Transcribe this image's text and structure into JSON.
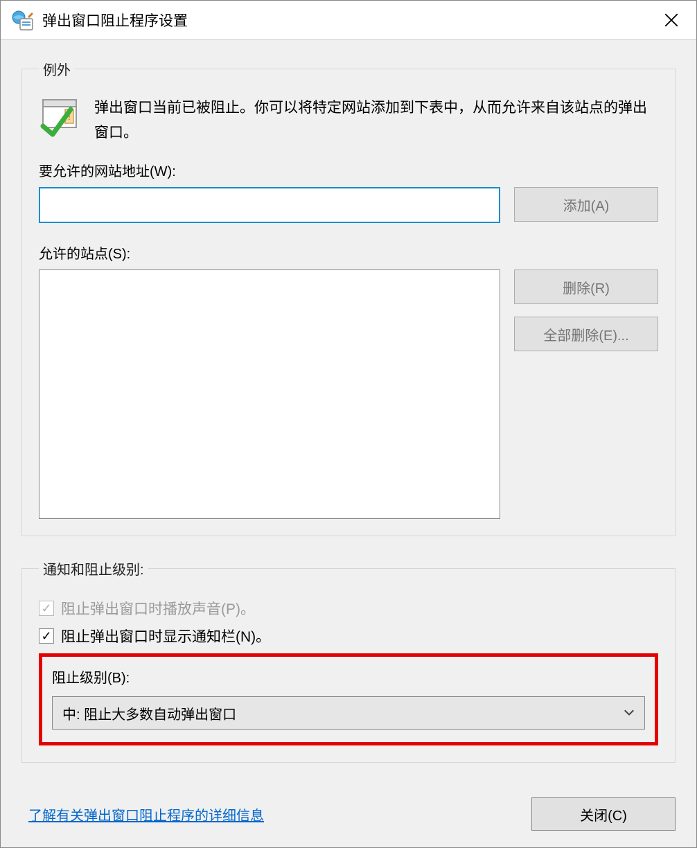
{
  "window": {
    "title": "弹出窗口阻止程序设置"
  },
  "exceptions": {
    "legend": "例外",
    "info": "弹出窗口当前已被阻止。你可以将特定网站添加到下表中，从而允许来自该站点的弹出窗口。",
    "address_label": "要允许的网站地址(W):",
    "add_button": "添加(A)",
    "allowed_label": "允许的站点(S):",
    "remove_button": "删除(R)",
    "remove_all_button": "全部删除(E)..."
  },
  "notifications": {
    "legend": "通知和阻止级别:",
    "play_sound": "阻止弹出窗口时播放声音(P)。",
    "show_bar": "阻止弹出窗口时显示通知栏(N)。",
    "block_level_label": "阻止级别(B):",
    "block_level_value": "中: 阻止大多数自动弹出窗口"
  },
  "footer": {
    "learn_more": "了解有关弹出窗口阻止程序的详细信息",
    "close": "关闭(C)"
  }
}
